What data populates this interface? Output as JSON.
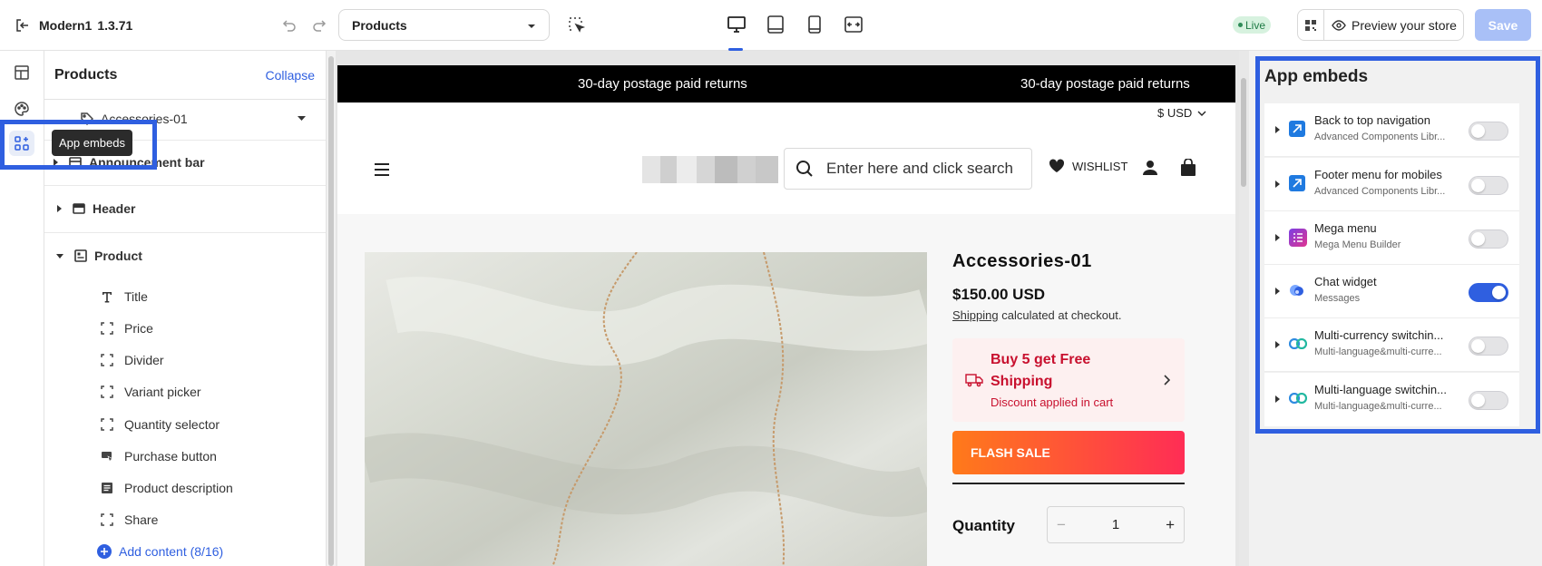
{
  "topbar": {
    "theme_name": "Modern1",
    "version": "1.3.71",
    "template_select": "Products",
    "live_badge": "Live",
    "preview_label": "Preview your store",
    "save_label": "Save"
  },
  "rail": {
    "tooltip": "App embeds"
  },
  "left_panel": {
    "title": "Products",
    "collapse_label": "Collapse",
    "product_select": "Accessories-01",
    "sections": [
      {
        "label": "Announcement bar"
      },
      {
        "label": "Header"
      },
      {
        "label": "Product"
      }
    ],
    "product_blocks": [
      {
        "label": "Title"
      },
      {
        "label": "Price"
      },
      {
        "label": "Divider"
      },
      {
        "label": "Variant picker"
      },
      {
        "label": "Quantity selector"
      },
      {
        "label": "Purchase button"
      },
      {
        "label": "Product description"
      },
      {
        "label": "Share"
      }
    ],
    "add_content": "Add content (8/16)"
  },
  "preview": {
    "announcement_1": "30-day postage paid returns",
    "announcement_2": "30-day postage paid returns",
    "currency": "$ USD",
    "search_placeholder": "Enter here and click search",
    "wishlist": "WISHLIST",
    "product_title": "Accessories-01",
    "price": "$150.00 USD",
    "shipping_link": "Shipping",
    "shipping_note": "calculated at checkout.",
    "promo_title": "Buy 5 get Free Shipping",
    "promo_sub": "Discount applied in cart",
    "flash_sale": "FLASH SALE",
    "quantity_label": "Quantity",
    "quantity_value": "1",
    "minus": "−",
    "plus": "+"
  },
  "app_embeds": {
    "title": "App embeds",
    "items": [
      {
        "name": "Back to top navigation",
        "source": "Advanced Components Libr...",
        "enabled": false
      },
      {
        "name": "Footer menu for mobiles",
        "source": "Advanced Components Libr...",
        "enabled": false
      },
      {
        "name": "Mega menu",
        "source": "Mega Menu Builder",
        "enabled": false
      },
      {
        "name": "Chat widget",
        "source": "Messages",
        "enabled": true
      },
      {
        "name": "Multi-currency switchin...",
        "source": "Multi-language&multi-curre...",
        "enabled": false
      },
      {
        "name": "Multi-language switchin...",
        "source": "Multi-language&multi-curre...",
        "enabled": false
      }
    ]
  },
  "colors": {
    "accent": "#2f5fe0",
    "promo_red": "#c8102e",
    "flash_start": "#ff7a1a",
    "flash_end": "#ff2d55",
    "live_green": "#2e8b57"
  }
}
